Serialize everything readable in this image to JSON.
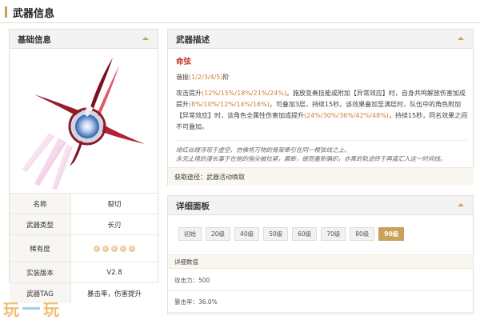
{
  "page": {
    "title": "武器信息"
  },
  "basic": {
    "header": "基础信息",
    "rows": [
      {
        "key": "名称",
        "value": "裂切"
      },
      {
        "key": "武器类型",
        "value": "长刃"
      },
      {
        "key": "稀有度",
        "stars": 5
      },
      {
        "key": "实装版本",
        "value": "V2.8"
      },
      {
        "key": "武器TAG",
        "value": "暴击率，伤害提升"
      }
    ]
  },
  "description": {
    "header": "武器描述",
    "skill_name": "命弦",
    "refine_label": "谐振",
    "refine_levels": "(1/2/3/4/5)",
    "refine_suffix": "阶",
    "effect": {
      "p1": "攻击提升",
      "v1": "(12%/15%/18%/21%/24%)",
      "p2": "。施放变奏技能或附加【异常效应】时，自身共鸣解放伤害加成提升",
      "v2": "(8%/10%/12%/14%/16%)",
      "p3": "，可叠加3层，持续15秒。该效果叠加至满层时，队伍中的角色附加【异常效应】时，该角色全属性伤害加成提升",
      "v3": "(24%/30%/36%/42%/48%)",
      "p4": "，持续15秒，同名效果之间不可叠加。"
    },
    "lore_1": "绯红丝缕浮现于虚空，仿佛将万物的骨架牵引在同一根弦线之上。",
    "lore_2": "永无止境的漫长事于在她的指尖被拉紧，震断，继而重新确织，亦真的轨迹终于再度汇入这一时间线。",
    "source_label": "获取途径：",
    "source_value": "武器活动唤取"
  },
  "detail": {
    "header": "详细面板",
    "tabs": [
      "初始",
      "20级",
      "40级",
      "50级",
      "60级",
      "70级",
      "80级",
      "90级"
    ],
    "active_tab": "90级",
    "stat_header": "详细数值",
    "stats": [
      {
        "text": "攻击力：500"
      },
      {
        "text": "暴击率：36.0%"
      }
    ]
  },
  "watermark": "玩一玩",
  "colors": {
    "accent": "#c8a15a",
    "skill_red": "#c13a2b",
    "value_orange": "#c8813a"
  }
}
